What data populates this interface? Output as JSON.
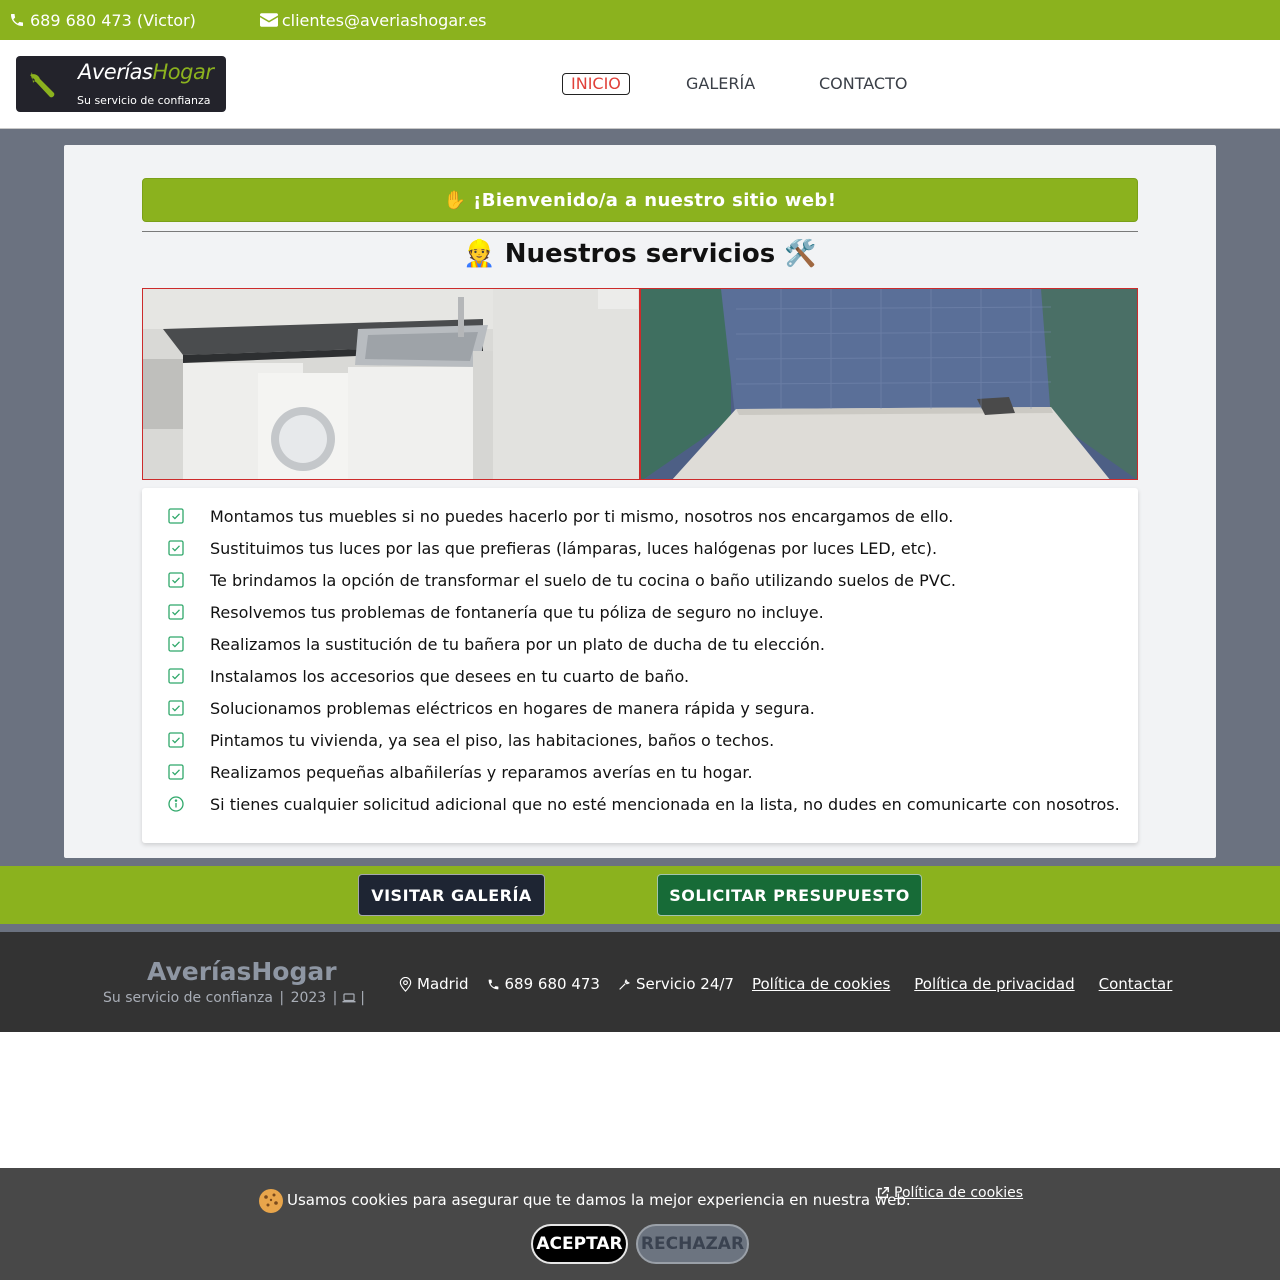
{
  "topbar": {
    "phone": "689 680 473 (Victor)",
    "email": "clientes@averiashogar.es"
  },
  "logo": {
    "brand_white": "Averías",
    "brand_green": "Hogar",
    "tagline": "Su servicio de confianza"
  },
  "nav": {
    "items": [
      {
        "label": "INICIO",
        "active": true
      },
      {
        "label": "GALERÍA",
        "active": false
      },
      {
        "label": "CONTACTO",
        "active": false
      }
    ]
  },
  "main": {
    "welcome": "✋ ¡Bienvenido/a a nuestro sitio web!",
    "services_title": "👷 Nuestros servicios 🛠️",
    "services": [
      "Montamos tus muebles si no puedes hacerlo por ti mismo, nosotros nos encargamos de ello.",
      "Sustituimos tus luces por las que prefieras (lámparas, luces halógenas por luces LED, etc).",
      "Te brindamos la opción de transformar el suelo de tu cocina o baño utilizando suelos de PVC.",
      "Resolvemos tus problemas de fontanería que tu póliza de seguro no incluye.",
      "Realizamos la sustitución de tu bañera por un plato de ducha de tu elección.",
      "Instalamos los accesorios que desees en tu cuarto de baño.",
      "Solucionamos problemas eléctricos en hogares de manera rápida y segura.",
      "Pintamos tu vivienda, ya sea el piso, las habitaciones, baños o techos.",
      "Realizamos pequeñas albañilerías y reparamos averías en tu hogar.",
      "Si tienes cualquier solicitud adicional que no esté mencionada en la lista, no dudes en comunicarte con nosotros."
    ]
  },
  "cta": {
    "gallery": "VISITAR GALERÍA",
    "quote": "SOLICITAR PRESUPUESTO"
  },
  "footer": {
    "brand": "AveríasHogar",
    "tagline": "Su servicio de confianza",
    "year": "2023",
    "location": "Madrid",
    "phone": "689 680 473",
    "service": "Servicio 24/7",
    "cookies_link": "Política de cookies",
    "privacy_link": "Política de privacidad",
    "contact_link": "Contactar"
  },
  "cookie_bar": {
    "message": "Usamos cookies para asegurar que te damos la mejor experiencia en nuestra web.",
    "policy_link": "Política de cookies",
    "accept": "ACEPTAR",
    "reject": "RECHAZAR"
  },
  "colors": {
    "accent_green": "#8bb21e",
    "dark_navy": "#1e2533",
    "quote_green": "#176b37",
    "footer_bg": "#333333",
    "check_green": "#2fa86a"
  }
}
